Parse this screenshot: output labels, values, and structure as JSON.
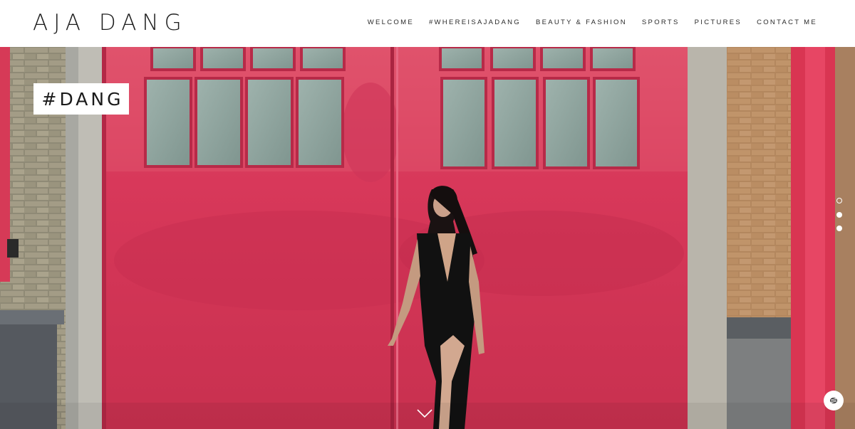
{
  "header": {
    "logo": "AJA DANG",
    "nav": [
      "WELCOME",
      "#WHEREISAJADANG",
      "BEAUTY & FASHION",
      "SPORTS",
      "PICTURES",
      "CONTACT ME"
    ]
  },
  "hero": {
    "tag": "#DANG",
    "slide_count": 3,
    "active_slide": 1
  },
  "icons": {
    "scroll": "chevron-down-icon",
    "badge": "site-badge-icon"
  },
  "colors": {
    "door_red": "#d83a5a",
    "brick": "#b88b62",
    "header_bg": "#ffffff",
    "text_dark": "#1d1d1d"
  }
}
